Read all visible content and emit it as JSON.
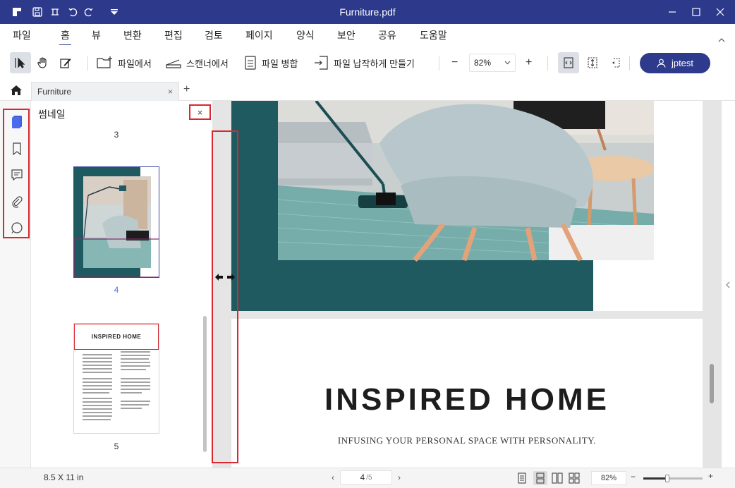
{
  "titlebar": {
    "title": "Furniture.pdf",
    "accent": "#2d3a8c"
  },
  "menu": {
    "items": [
      {
        "label": "파일"
      },
      {
        "label": "홈",
        "active": true
      },
      {
        "label": "뷰"
      },
      {
        "label": "변환"
      },
      {
        "label": "편집"
      },
      {
        "label": "검토"
      },
      {
        "label": "페이지"
      },
      {
        "label": "양식"
      },
      {
        "label": "보안"
      },
      {
        "label": "공유"
      },
      {
        "label": "도움말"
      }
    ]
  },
  "toolbar": {
    "from_file": "파일에서",
    "from_scanner": "스캔너에서",
    "merge": "파일 병합",
    "compress": "파일 납작하게 만들기",
    "zoom_value": "82%",
    "zoom_out": "−",
    "zoom_in": "+",
    "user": "jptest"
  },
  "tabs": {
    "doc_tab": "Furniture",
    "close": "×",
    "add": "+"
  },
  "panel": {
    "title": "썸네일",
    "close": "×",
    "pages": [
      "3",
      "4",
      "5"
    ],
    "active_page": "4",
    "thumb5_title": "INSPIRED HOME"
  },
  "document": {
    "page5_title": "INSPIRED HOME",
    "page5_subtitle": "INFUSING YOUR PERSONAL SPACE WITH PERSONALITY.",
    "brand_teal": "#1f5a60"
  },
  "status": {
    "page_size": "8.5 X 11 in",
    "current_page": "4",
    "total_pages": "/5",
    "prev": "‹",
    "next": "›",
    "zoom": "82%",
    "zoom_minus": "−",
    "zoom_plus": "+",
    "zoom_fraction": 0.4
  }
}
